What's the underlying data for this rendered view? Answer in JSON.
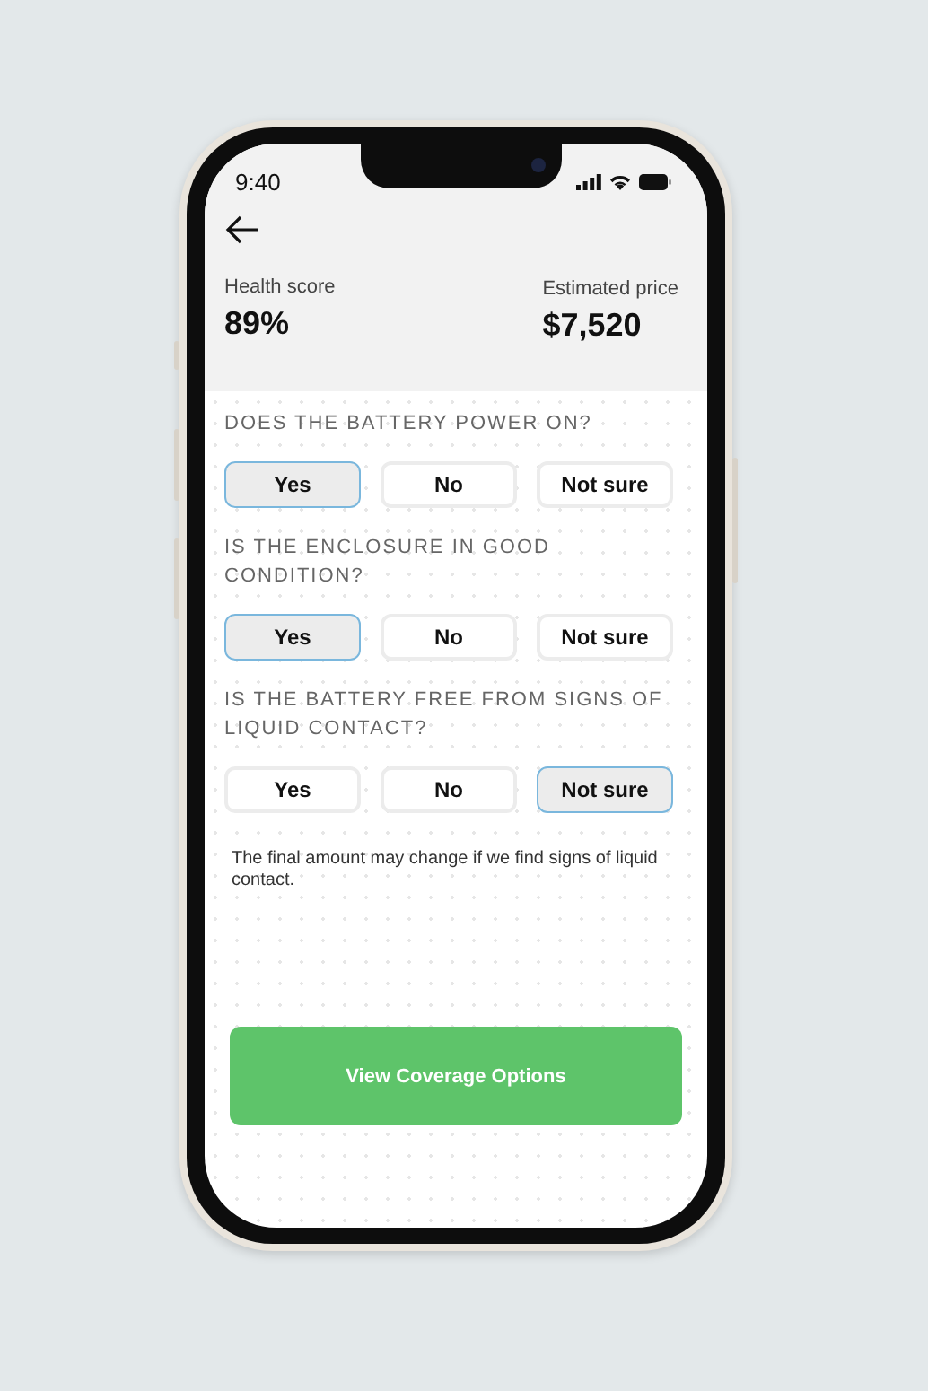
{
  "status_bar": {
    "time": "9:40"
  },
  "summary": [
    {
      "label": "Health score",
      "value": "89%"
    },
    {
      "label": "Estimated price",
      "value": "$7,520"
    }
  ],
  "questions": [
    {
      "title": "DOES THE BATTERY POWER ON?",
      "options": [
        {
          "label": "Yes",
          "selected": true
        },
        {
          "label": "No",
          "selected": false
        },
        {
          "label": "Not sure",
          "selected": false
        }
      ]
    },
    {
      "title": "IS THE ENCLOSURE IN GOOD CONDITION?",
      "options": [
        {
          "label": "Yes",
          "selected": true
        },
        {
          "label": "No",
          "selected": false
        },
        {
          "label": "Not sure",
          "selected": false
        }
      ]
    },
    {
      "title": "IS THE BATTERY FREE FROM SIGNS OF LIQUID CONTACT?",
      "options": [
        {
          "label": "Yes",
          "selected": false
        },
        {
          "label": "No",
          "selected": false
        },
        {
          "label": "Not sure",
          "selected": true
        }
      ]
    }
  ],
  "note": "The final amount may change if we find signs of liquid contact.",
  "primary_button": "View Coverage Options"
}
